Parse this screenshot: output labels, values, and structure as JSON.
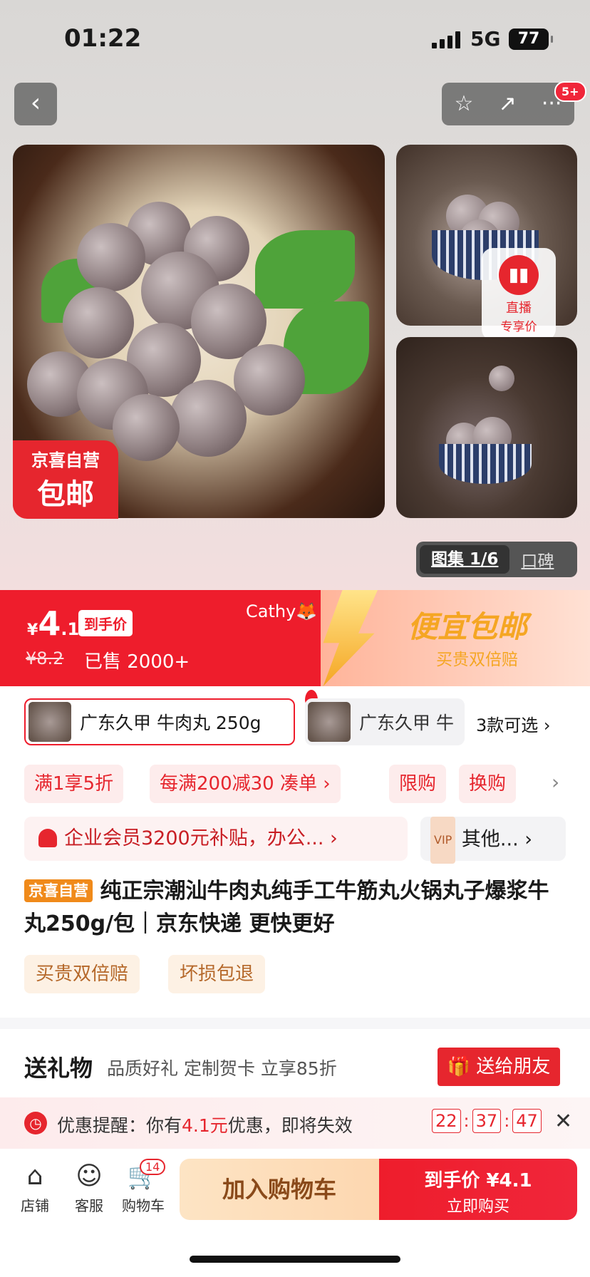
{
  "status": {
    "time": "01:22",
    "network": "5G",
    "battery": "77"
  },
  "nav": {
    "back": "‹",
    "star": "☆",
    "share": "↗",
    "more": "···",
    "badge": "5+"
  },
  "gallery": {
    "tag_line1": "京喜自营",
    "tag_line2": "包邮",
    "live_line1": "直播",
    "live_line2": "专享价",
    "gallery_label": "图集 1/6",
    "review_label": "口碑"
  },
  "price": {
    "currency": "¥",
    "int": "4",
    "dec": ".1",
    "tag": "到手价",
    "original": "¥8.2",
    "sold": "已售 2000+",
    "cathy": "Cathy🦊",
    "promo_title": "便宜包邮",
    "promo_sub": "买贵双倍赔"
  },
  "sku": {
    "sku1": "广东久甲 牛肉丸  250g",
    "sku2": "广东久甲 牛",
    "more": "3款可选 ›"
  },
  "promos": [
    "满1享5折",
    "每满200减30  凑单 ›",
    "限购",
    "换购"
  ],
  "promo_more": "›",
  "member": {
    "text": "企业会员3200元补贴，办公...  ›",
    "other": "其他...  ›",
    "vip": "VIP"
  },
  "title": {
    "tag": "京喜自营",
    "text": "纯正宗潮汕牛肉丸纯手工牛筋丸火锅丸子爆浆牛丸250g/包｜京东快递 更快更好"
  },
  "tags": [
    "买贵双倍赔",
    "坏损包退"
  ],
  "gift": {
    "heading": "送礼物",
    "sub": "品质好礼 定制贺卡 立享85折",
    "button": "送给朋友"
  },
  "remind": {
    "prefix": "优惠提醒：你有",
    "amount": "4.1元",
    "suffix": "优惠，即将失效",
    "h": "22",
    "m": "37",
    "s": "47",
    "close": "✕"
  },
  "bottom": {
    "shop": "店铺",
    "service": "客服",
    "cart": "购物车",
    "cart_count": "14",
    "add_cart": "加入购物车",
    "buy_price": "到手价 ¥4.1",
    "buy_now": "立即购买"
  }
}
